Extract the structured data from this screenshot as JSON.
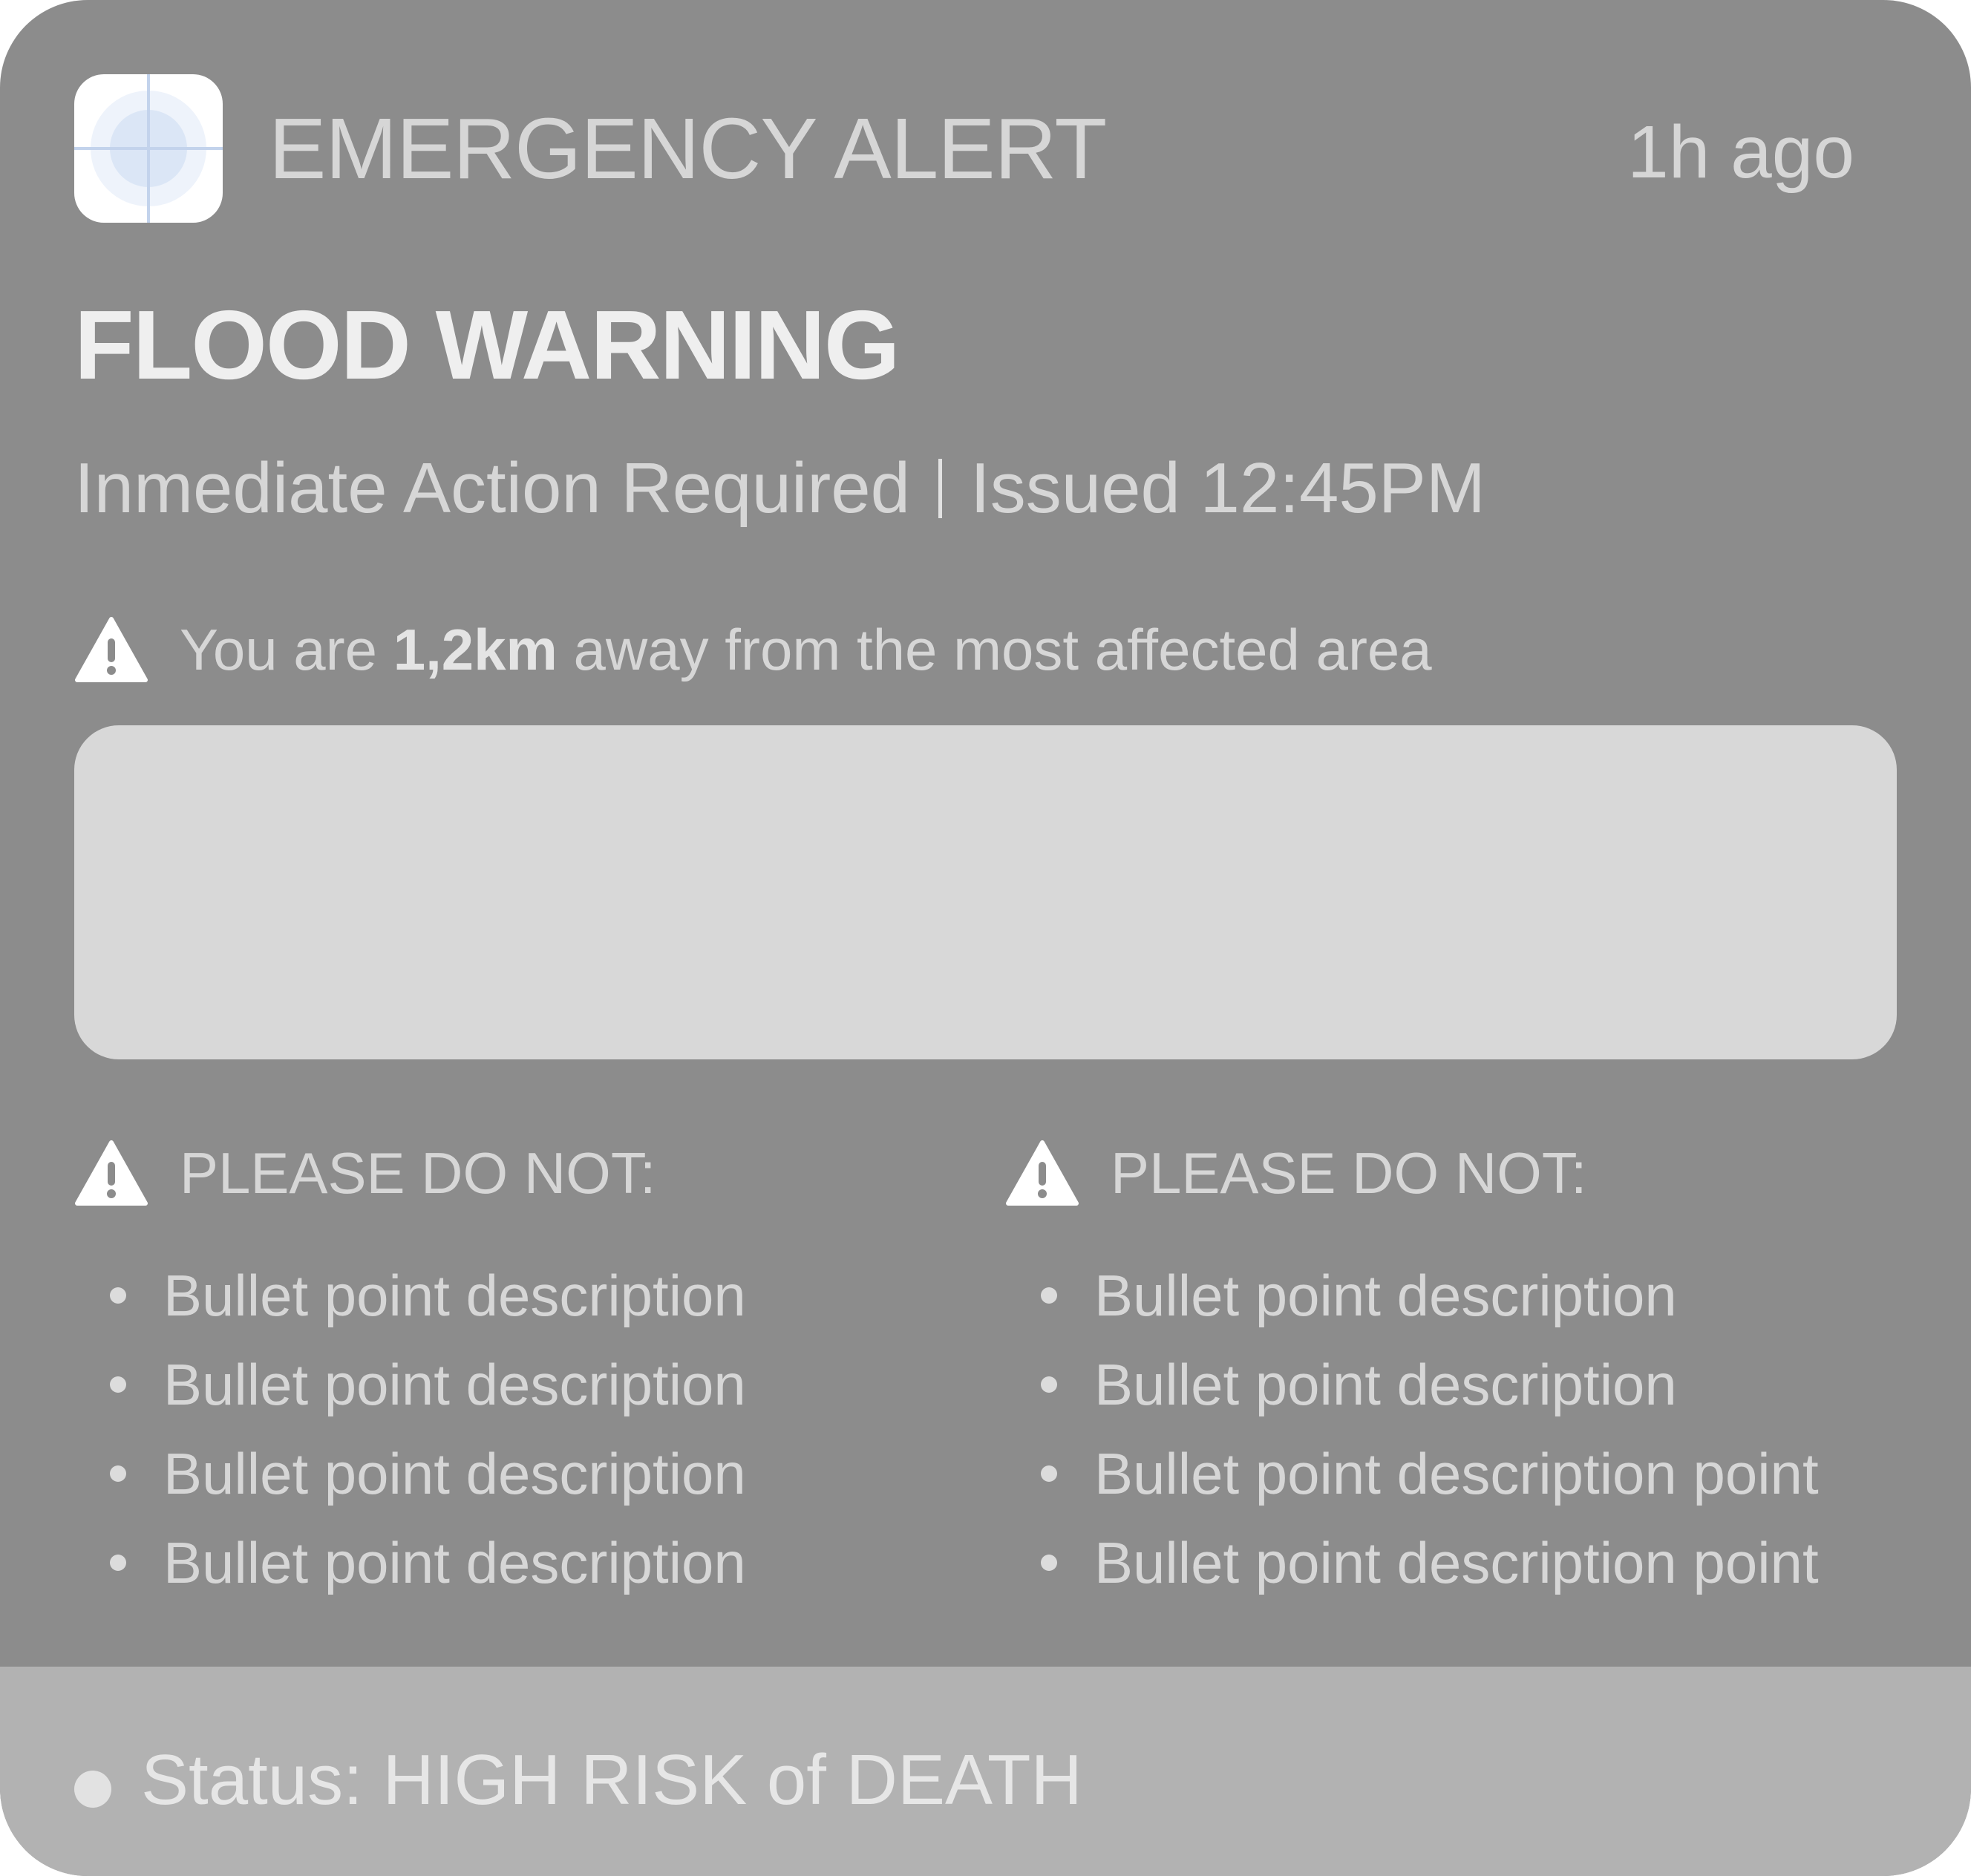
{
  "header": {
    "app_icon": "target-crosshair-icon",
    "app_name": "EMERGENCY ALERT",
    "time_ago": "1h ago"
  },
  "alert": {
    "title": "FLOOD WARNING",
    "action_text": "Inmediate Action Required",
    "issued_text": "Issued 12:45PM"
  },
  "distance": {
    "icon": "warning-triangle-icon",
    "prefix": "You are ",
    "value": "1,2km",
    "suffix": " away from the most affected area"
  },
  "columns": [
    {
      "icon": "warning-triangle-icon",
      "header": "PLEASE DO NOT:",
      "items": [
        "Bullet point description",
        "Bullet point description",
        "Bullet point description",
        "Bullet point description"
      ]
    },
    {
      "icon": "warning-triangle-icon",
      "header": "PLEASE DO NOT:",
      "items": [
        "Bullet point description",
        "Bullet point description",
        "Bullet point description point",
        "Bullet point description point"
      ]
    }
  ],
  "status": {
    "text": "Status: HIGH RISK of DEATH"
  },
  "colors": {
    "card_background": "#8c8c8c",
    "status_background": "#b2b2b2",
    "map_placeholder": "#d8d8d8",
    "text_light": "#d6d6d6",
    "icon_accent": "#dbe6f6"
  }
}
